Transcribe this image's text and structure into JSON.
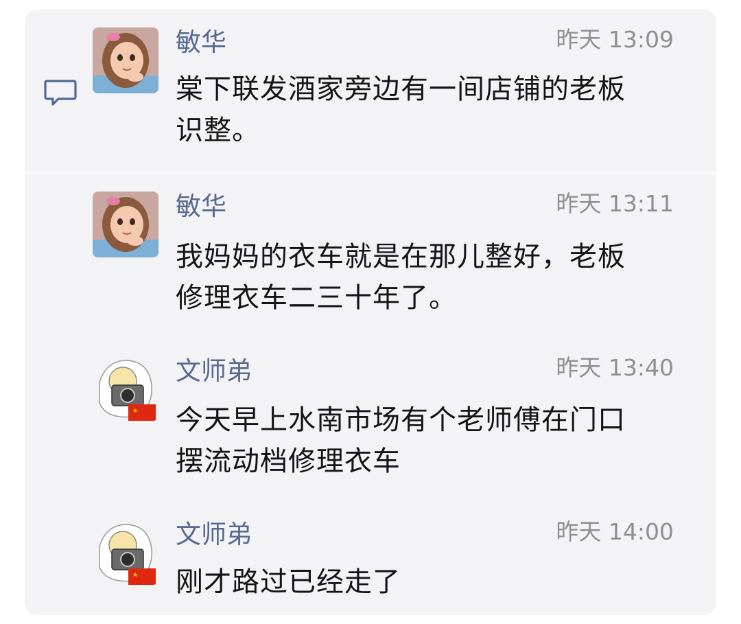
{
  "messages": [
    {
      "sender": "敏华",
      "time": "昨天 13:09",
      "lines": [
        "棠下联发酒家旁边有一间店铺的老板",
        "识整。"
      ]
    },
    {
      "sender": "敏华",
      "time": "昨天 13:11",
      "lines": [
        "我妈妈的衣车就是在那儿整好，老板",
        "修理衣车二三十年了。"
      ]
    },
    {
      "sender": "文师弟",
      "time": "昨天 13:40",
      "lines": [
        "今天早上水南市场有个老师傅在门口",
        "摆流动档修理衣车"
      ]
    },
    {
      "sender": "文师弟",
      "time": "昨天 14:00",
      "lines": [
        "刚才路过已经走了"
      ]
    }
  ],
  "icons": {
    "reply": "comment-bubble-icon",
    "avatar_girl": "cartoon-girl-avatar",
    "avatar_camera": "cartoon-camera-flag-avatar"
  },
  "colors": {
    "sender": "#57698f",
    "time": "#8f8f93",
    "text": "#141414",
    "panel": "#f3f3f5"
  }
}
